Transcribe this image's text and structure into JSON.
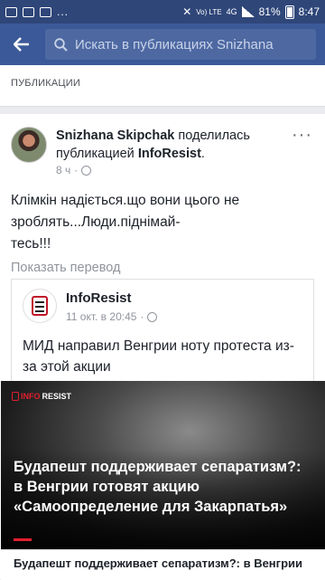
{
  "status_bar": {
    "more": "...",
    "network": "Vo) LTE",
    "net_type": "4G",
    "battery": "81%",
    "time": "8:47"
  },
  "search": {
    "placeholder": "Искать в публикациях Snizhana"
  },
  "section": {
    "title": "ПУБЛИКАЦИИ"
  },
  "post": {
    "author": "Snizhana Skipchak",
    "action": "поделилась публикацией",
    "shared_page": "InfoResist",
    "time": "8 ч",
    "more": "···",
    "text": "Клімкін надіється.що вони цього не зроблять...Люди.піднімай-\nтесь!!!",
    "translate": "Показать перевод"
  },
  "shared": {
    "source": "InfoResist",
    "time": "11 окт. в 20:45",
    "text": "МИД направил Венгрии ноту протеста из-за этой акции",
    "article_logo_a": "INFO",
    "article_logo_b": "RESIST",
    "article_title": "Будапешт поддерживает сепаратизм?: в Венгрии готовят акцию «Самоопределение для Закарпатья»",
    "caption": "Будапешт поддерживает сепаратизм?: в Венгрии"
  },
  "colors": {
    "header": "#3b5998",
    "status": "#2f4679",
    "brand_red": "#e21f2f"
  }
}
